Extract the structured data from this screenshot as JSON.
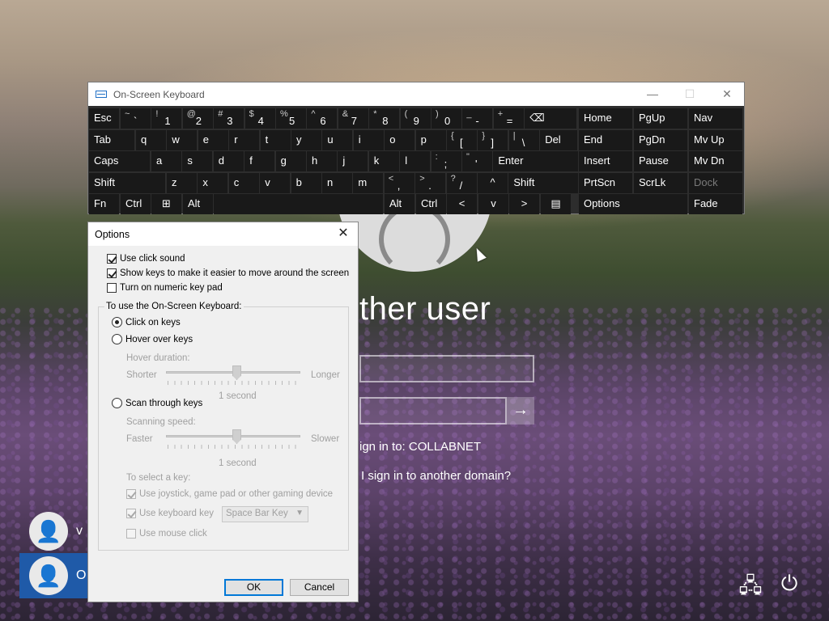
{
  "login": {
    "title": "ther user",
    "signin_to": "ign in to: COLLABNET",
    "domain_link": "I sign in to another domain?",
    "submit_arrow": "→",
    "users": [
      {
        "name": "v"
      },
      {
        "name": "O"
      }
    ]
  },
  "osk": {
    "title": "On-Screen Keyboard",
    "controls": {
      "minimize": "—",
      "maximize": "☐",
      "close": "✕"
    },
    "keys": {
      "esc": "Esc",
      "tab": "Tab",
      "caps": "Caps",
      "shift_l": "Shift",
      "fn": "Fn",
      "ctrl_l": "Ctrl",
      "win": "⊞",
      "alt_l": "Alt",
      "num_row": [
        {
          "top": "~",
          "bot": "`"
        },
        {
          "top": "!",
          "bot": "1"
        },
        {
          "top": "@",
          "bot": "2"
        },
        {
          "top": "#",
          "bot": "3"
        },
        {
          "top": "$",
          "bot": "4"
        },
        {
          "top": "%",
          "bot": "5"
        },
        {
          "top": "^",
          "bot": "6"
        },
        {
          "top": "&",
          "bot": "7"
        },
        {
          "top": "*",
          "bot": "8"
        },
        {
          "top": "(",
          "bot": "9"
        },
        {
          "top": ")",
          "bot": "0"
        },
        {
          "top": "_",
          "bot": "-"
        },
        {
          "top": "+",
          "bot": "="
        }
      ],
      "backspace": "⌫",
      "row_q": [
        "q",
        "w",
        "e",
        "r",
        "t",
        "y",
        "u",
        "i",
        "o",
        "p"
      ],
      "brackets": [
        {
          "top": "{",
          "bot": "["
        },
        {
          "top": "}",
          "bot": "]"
        },
        {
          "top": "|",
          "bot": "\\"
        }
      ],
      "del": "Del",
      "row_a": [
        "a",
        "s",
        "d",
        "f",
        "g",
        "h",
        "j",
        "k",
        "l"
      ],
      "semis": [
        {
          "top": ":",
          "bot": ";"
        },
        {
          "top": "\"",
          "bot": "'"
        }
      ],
      "enter": "Enter",
      "row_z": [
        "z",
        "x",
        "c",
        "v",
        "b",
        "n",
        "m"
      ],
      "puncts": [
        {
          "top": "<",
          "bot": ","
        },
        {
          "top": ">",
          "bot": "."
        },
        {
          "top": "?",
          "bot": "/"
        }
      ],
      "up": "^",
      "shift_r": "Shift",
      "alt_r": "Alt",
      "ctrl_r": "Ctrl",
      "left": "<",
      "down": "v",
      "right": ">",
      "menu": "▤",
      "nav_col1": [
        "Home",
        "End",
        "Insert",
        "PrtScn",
        "Options"
      ],
      "nav_col2": [
        "PgUp",
        "PgDn",
        "Pause",
        "ScrLk"
      ],
      "nav_col3": [
        "Nav",
        "Mv Up",
        "Mv Dn",
        "Dock",
        "Fade"
      ]
    }
  },
  "options": {
    "title": "Options",
    "close": "✕",
    "use_click_sound": "Use click sound",
    "show_keys": "Show keys to make it easier to move around the screen",
    "numeric_keypad": "Turn on numeric key pad",
    "group_label": "To use the On-Screen Keyboard:",
    "click_on_keys": "Click on keys",
    "hover_over_keys": "Hover over keys",
    "hover_duration": "Hover duration:",
    "shorter": "Shorter",
    "longer": "Longer",
    "hover_value": "1 second",
    "scan_through_keys": "Scan through keys",
    "scanning_speed": "Scanning speed:",
    "faster": "Faster",
    "slower": "Slower",
    "scan_value": "1 second",
    "to_select": "To select a key:",
    "use_joystick": "Use joystick, game pad or other gaming device",
    "use_keyboard_key": "Use keyboard key",
    "keyboard_key_value": "Space Bar Key",
    "use_mouse_click": "Use mouse click",
    "ok": "OK",
    "cancel": "Cancel"
  }
}
